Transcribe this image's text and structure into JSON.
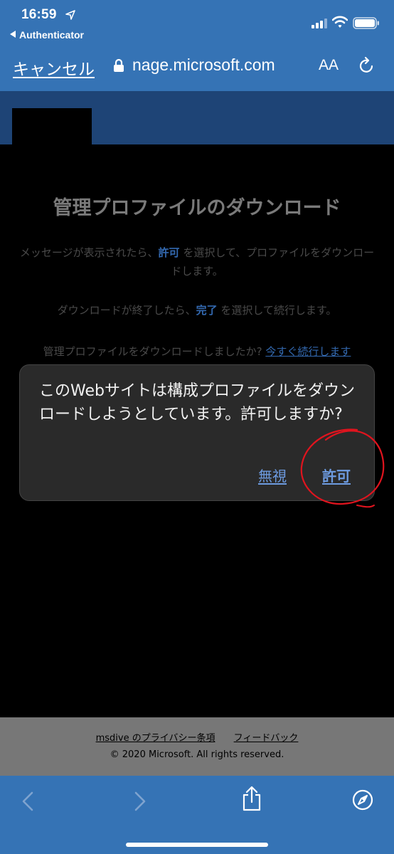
{
  "status_bar": {
    "time": "16:59",
    "back_app": "Authenticator"
  },
  "browser": {
    "cancel_label": "キャンセル",
    "url": "nage.microsoft.com",
    "text_size_label": "AA"
  },
  "page": {
    "title": "管理プロファイルのダウンロード",
    "para1_before": "メッセージが表示されたら、",
    "para1_bold": "許可",
    "para1_after": " を選択して、プロファイルをダウンロードします。",
    "para2_before": "ダウンロードが終了したら、",
    "para2_bold": "完了",
    "para2_after": " を選択して続行します。",
    "para3_before": "管理プロファイルをダウンロードしましたか? ",
    "para3_link": "今すぐ続行します"
  },
  "dialog": {
    "message": "このWebサイトは構成プロファイルをダウンロードしようとしています。許可しますか?",
    "ignore_label": "無視",
    "allow_label": "許可"
  },
  "footer": {
    "privacy_link": "msdive のプライバシー条項",
    "feedback_link": "フィードバック",
    "copyright": "© 2020 Microsoft. All rights reserved."
  },
  "colors": {
    "browser_blue": "#3573B5",
    "band_blue": "#1E4476",
    "link_blue": "#6d9be0",
    "annotation_red": "#e0141e"
  }
}
